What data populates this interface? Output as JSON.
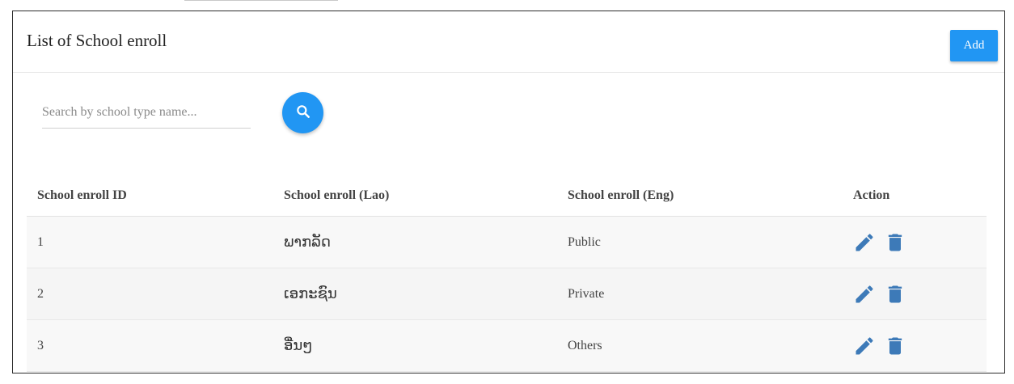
{
  "page": {
    "title": "List of School enroll",
    "add_label": "Add"
  },
  "search": {
    "placeholder": "Search by school type name...",
    "value": "",
    "button_icon": "search-icon"
  },
  "table": {
    "headers": [
      "School enroll ID",
      "School enroll (Lao)",
      "School enroll (Eng)",
      "Action"
    ],
    "rows": [
      {
        "id": "1",
        "lao": "ພາກລັດ",
        "eng": "Public"
      },
      {
        "id": "2",
        "lao": "ເອກະຊົນ",
        "eng": "Private"
      },
      {
        "id": "3",
        "lao": "ອື່ນໆ",
        "eng": "Others"
      }
    ],
    "action_icons": [
      "edit-icon",
      "delete-icon"
    ]
  },
  "colors": {
    "accent": "#2196f3",
    "icon": "#3d7ab8"
  }
}
